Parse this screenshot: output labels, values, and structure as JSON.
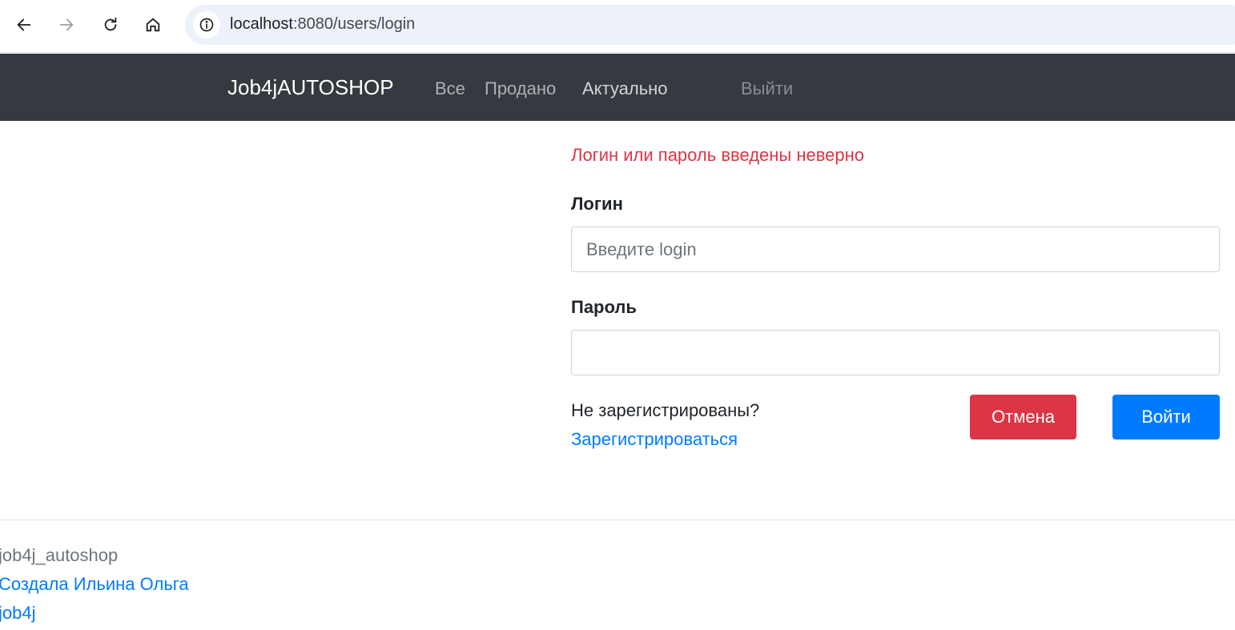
{
  "browser": {
    "url_host": "localhost",
    "url_path": ":8080/users/login",
    "icons": {
      "back": "arrow-left-icon",
      "forward": "arrow-right-icon",
      "reload": "reload-icon",
      "home": "home-icon",
      "site_info": "info-icon"
    }
  },
  "navbar": {
    "brand": "Job4jAUTOSHOP",
    "links": {
      "all": "Все",
      "sold": "Продано",
      "actual": "Актуально",
      "logout": "Выйти"
    },
    "background": "#343a40"
  },
  "login_form": {
    "error_message": "Логин или пароль введены неверно",
    "login_label": "Логин",
    "login_placeholder": "Введите login",
    "login_value": "",
    "password_label": "Пароль",
    "password_value": "",
    "register_question": "Не зарегистрированы?",
    "register_link": "Зарегистрироваться",
    "cancel_button": "Отмена",
    "submit_button": "Войти",
    "colors": {
      "error": "#dc3545",
      "cancel": "#dc3545",
      "primary": "#007bff"
    }
  },
  "footer": {
    "project_name": "job4j_autoshop",
    "author": "Создала Ильина Ольга",
    "job4j": "job4j"
  }
}
